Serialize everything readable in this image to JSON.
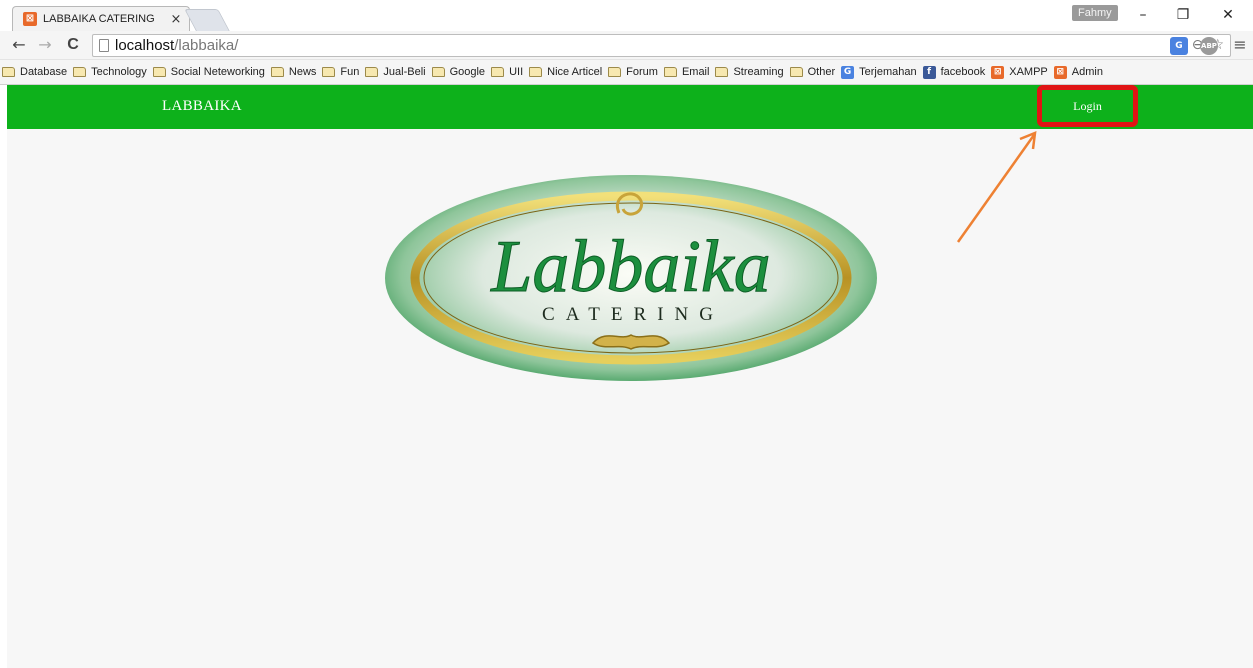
{
  "browser": {
    "tab_title": "LABBAIKA CATERING",
    "tab_close": "×",
    "profile_name": "Fahmy",
    "window_buttons": {
      "minimize": "–",
      "restore": "❐",
      "close": "✕"
    },
    "nav": {
      "back": "←",
      "forward": "→",
      "reload": "C"
    },
    "url_host": "localhost",
    "url_path": "/labbaika/",
    "menu_icon": "≡",
    "extensions": {
      "translate": "G",
      "adblock": "ABP"
    },
    "bookmarks": [
      {
        "label": "Database",
        "icon": "folder-icon"
      },
      {
        "label": "Technology",
        "icon": "folder-icon"
      },
      {
        "label": "Social Neteworking",
        "icon": "folder-icon"
      },
      {
        "label": "News",
        "icon": "folder-icon"
      },
      {
        "label": "Fun",
        "icon": "folder-icon"
      },
      {
        "label": "Jual-Beli",
        "icon": "folder-icon"
      },
      {
        "label": "Google",
        "icon": "folder-icon"
      },
      {
        "label": "UII",
        "icon": "folder-icon"
      },
      {
        "label": "Nice Articel",
        "icon": "folder-icon"
      },
      {
        "label": "Forum",
        "icon": "folder-icon"
      },
      {
        "label": "Email",
        "icon": "folder-icon"
      },
      {
        "label": "Streaming",
        "icon": "folder-icon"
      },
      {
        "label": "Other",
        "icon": "folder-icon"
      },
      {
        "label": "Terjemahan",
        "icon": "translate-icon"
      },
      {
        "label": "facebook",
        "icon": "facebook-icon"
      },
      {
        "label": "XAMPP",
        "icon": "xampp-icon"
      },
      {
        "label": "Admin",
        "icon": "xampp-icon"
      }
    ]
  },
  "page": {
    "brand": "LABBAIKA",
    "login_label": "Login",
    "logo_text": "Labbaika",
    "logo_subtext": "CATERING"
  },
  "colors": {
    "navbar": "#0db11b",
    "highlight_box": "#e01414",
    "annotation_arrow": "#ee8133",
    "logo_green": "#1c8f3e",
    "logo_gold": "#c8a43a"
  }
}
